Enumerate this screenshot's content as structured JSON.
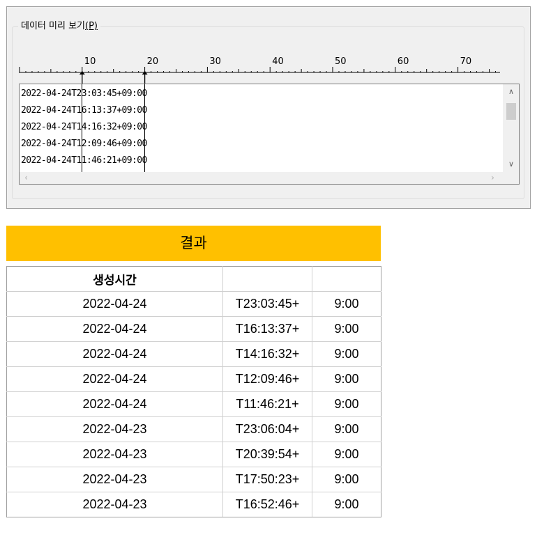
{
  "dialog": {
    "group_title": "데이터 미리 보기",
    "group_title_mnemonic": "(P)"
  },
  "ruler": {
    "labels": [
      "10",
      "20",
      "30",
      "40",
      "50",
      "60",
      "70"
    ],
    "column_breaks": [
      10,
      20
    ]
  },
  "preview": {
    "lines": [
      "2022-04-24T23:03:45+09:00",
      "2022-04-24T16:13:37+09:00",
      "2022-04-24T14:16:32+09:00",
      "2022-04-24T12:09:46+09:00",
      "2022-04-24T11:46:21+09:00"
    ],
    "scroll_up_icon": "chevron-up-icon",
    "scroll_down_icon": "chevron-down-icon",
    "scroll_left_icon": "chevron-left-icon",
    "scroll_right_icon": "chevron-right-icon"
  },
  "result": {
    "title": "결과",
    "header_color": "#ffc000",
    "columns": [
      "생성시간",
      "",
      ""
    ],
    "rows": [
      [
        "2022-04-24",
        "T23:03:45+",
        "9:00"
      ],
      [
        "2022-04-24",
        "T16:13:37+",
        "9:00"
      ],
      [
        "2022-04-24",
        "T14:16:32+",
        "9:00"
      ],
      [
        "2022-04-24",
        "T12:09:46+",
        "9:00"
      ],
      [
        "2022-04-24",
        "T11:46:21+",
        "9:00"
      ],
      [
        "2022-04-23",
        "T23:06:04+",
        "9:00"
      ],
      [
        "2022-04-23",
        "T20:39:54+",
        "9:00"
      ],
      [
        "2022-04-23",
        "T17:50:23+",
        "9:00"
      ],
      [
        "2022-04-23",
        "T16:52:46+",
        "9:00"
      ]
    ]
  }
}
